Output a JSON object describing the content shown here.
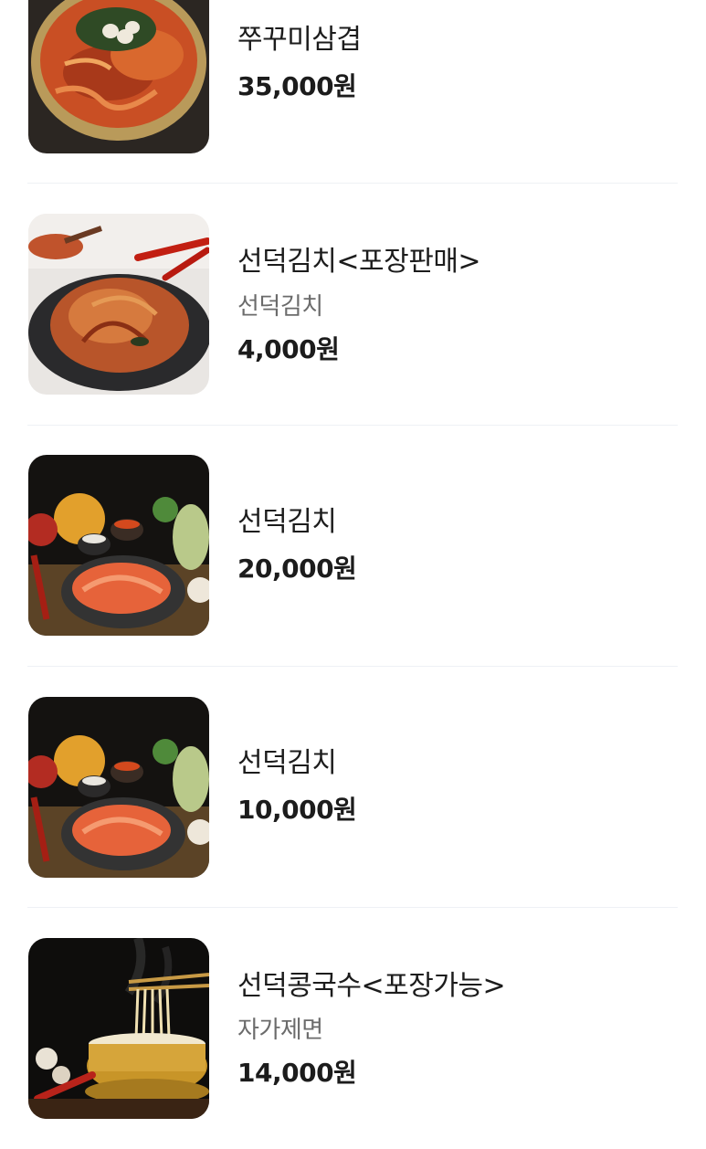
{
  "menu": {
    "items": [
      {
        "name": "쭈꾸미삼겹",
        "description": "",
        "price": "35,000원",
        "image": "jjukkumi-samgyeop-photo"
      },
      {
        "name": "선덕김치<포장판매>",
        "description": "선덕김치",
        "price": "4,000원",
        "image": "kimchi-takeout-photo"
      },
      {
        "name": "선덕김치",
        "description": "",
        "price": "20,000원",
        "image": "kimchi-large-photo"
      },
      {
        "name": "선덕김치",
        "description": "",
        "price": "10,000원",
        "image": "kimchi-small-photo"
      },
      {
        "name": "선덕콩국수<포장가능>",
        "description": "자가제면",
        "price": "14,000원",
        "image": "kongguksu-photo"
      }
    ]
  },
  "colors": {
    "divider": "#eef1f5",
    "text_primary": "#1c1c1c",
    "text_secondary": "#6b6b6b"
  }
}
